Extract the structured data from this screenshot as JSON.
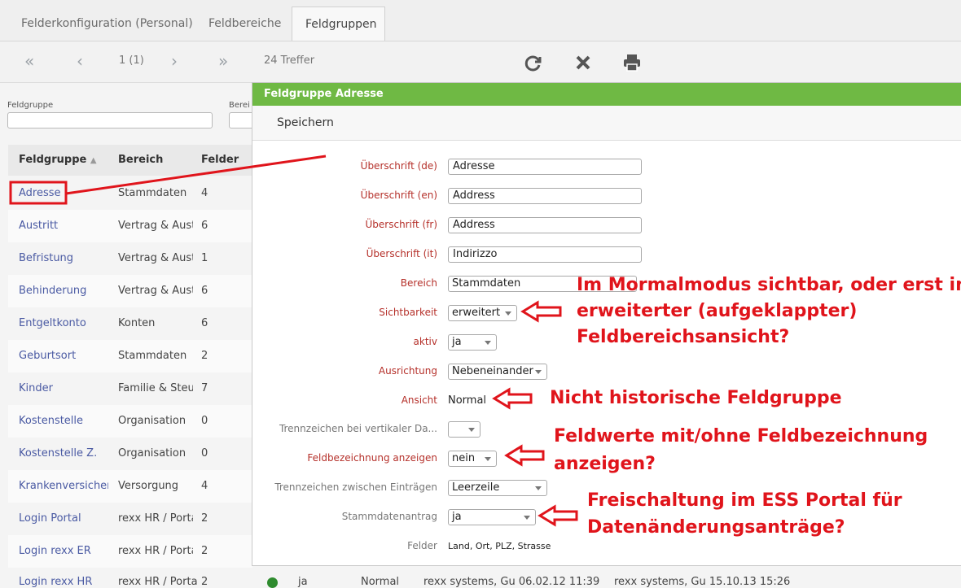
{
  "tabs": [
    {
      "label": "Felderkonfiguration (Personal)"
    },
    {
      "label": "Feldbereiche"
    },
    {
      "label": "Feldgruppen"
    }
  ],
  "toolbar": {
    "page": "1 (1)",
    "hits": "24 Treffer"
  },
  "filters": {
    "feldgruppe_label": "Feldgruppe",
    "bereich_label": "Berei"
  },
  "grid": {
    "columns": [
      "Feldgruppe",
      "Bereich",
      "Felder"
    ],
    "rows": [
      [
        "Adresse",
        "Stammdaten",
        "4"
      ],
      [
        "Austritt",
        "Vertrag & Aust",
        "6"
      ],
      [
        "Befristung",
        "Vertrag & Aust",
        "1"
      ],
      [
        "Behinderung",
        "Vertrag & Aust",
        "6"
      ],
      [
        "Entgeltkonto",
        "Konten",
        "6"
      ],
      [
        "Geburtsort",
        "Stammdaten",
        "2"
      ],
      [
        "Kinder",
        "Familie & Steue",
        "7"
      ],
      [
        "Kostenstelle",
        "Organisation",
        "0"
      ],
      [
        "Kostenstelle Z.",
        "Organisation",
        "0"
      ],
      [
        "Krankenversichert",
        "Versorgung",
        "4"
      ],
      [
        "Login Portal",
        "rexx HR / Porta",
        "2"
      ],
      [
        "Login rexx ER",
        "rexx HR / Porta",
        "2"
      ]
    ],
    "partial_row": [
      "Login rexx HR",
      "rexx HR / Porta",
      "2",
      "ja",
      "Normal",
      "rexx systems, Gu 06.02.12 11:39",
      "rexx systems, Gu 15.10.13 15:26"
    ]
  },
  "modal": {
    "title": "Feldgruppe Adresse",
    "save_label": "Speichern",
    "fields": {
      "ueberschrift_de": {
        "label": "Überschrift (de)",
        "value": "Adresse"
      },
      "ueberschrift_en": {
        "label": "Überschrift (en)",
        "value": "Address"
      },
      "ueberschrift_fr": {
        "label": "Überschrift (fr)",
        "value": "Address"
      },
      "ueberschrift_it": {
        "label": "Überschrift (it)",
        "value": "Indirizzo"
      },
      "bereich": {
        "label": "Bereich",
        "value": "Stammdaten"
      },
      "sichtbarkeit": {
        "label": "Sichtbarkeit",
        "value": "erweitert"
      },
      "aktiv": {
        "label": "aktiv",
        "value": "ja"
      },
      "ausrichtung": {
        "label": "Ausrichtung",
        "value": "Nebeneinander"
      },
      "ansicht": {
        "label": "Ansicht",
        "value": "Normal"
      },
      "trenn_vertikal": {
        "label": "Trennzeichen bei vertikaler Da...",
        "value": ""
      },
      "feldbezeichnung": {
        "label": "Feldbezeichnung anzeigen",
        "value": "nein"
      },
      "trenn_eintraege": {
        "label": "Trennzeichen zwischen Einträgen",
        "value": "Leerzeile"
      },
      "stammdatenantrag": {
        "label": "Stammdatenantrag",
        "value": "ja"
      },
      "felder": {
        "label": "Felder",
        "value": "Land, Ort, PLZ, Strasse"
      }
    }
  },
  "annotations": {
    "a1_l1": "Im Mormalmodus sichtbar, oder erst in",
    "a1_l2": "erweiterter (aufgeklappter)",
    "a1_l3": "Feldbereichsansicht?",
    "a2": "Nicht historische Feldgruppe",
    "a3_l1": "Feldwerte mit/ohne Feldbezeichnung",
    "a3_l2": "anzeigen?",
    "a4_l1": "Freischaltung im ESS Portal für",
    "a4_l2": "Datenänderungsanträge?"
  },
  "colors": {
    "header_green": "#6fb944",
    "annotation_red": "#e0141b",
    "link_blue": "#4a5aa3",
    "required_label": "#b5302a"
  }
}
